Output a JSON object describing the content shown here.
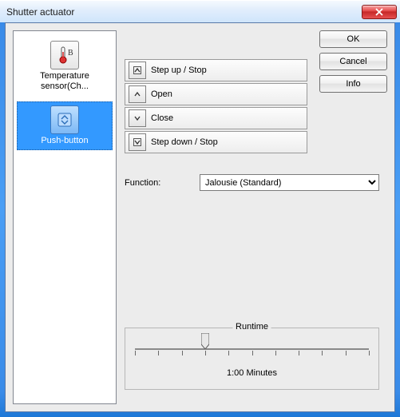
{
  "window": {
    "title": "Shutter actuator"
  },
  "buttons": {
    "ok": "OK",
    "cancel": "Cancel",
    "info": "Info"
  },
  "sidebar": {
    "items": [
      {
        "id": "temperature-sensor",
        "label": "Temperature sensor(Ch...",
        "selected": false
      },
      {
        "id": "push-button",
        "label": "Push-button",
        "selected": true
      }
    ]
  },
  "actions": [
    {
      "icon": "chevron-up-boxed-icon",
      "label": "Step up / Stop"
    },
    {
      "icon": "chevron-up-icon",
      "label": "Open"
    },
    {
      "icon": "chevron-down-icon",
      "label": "Close"
    },
    {
      "icon": "chevron-down-boxed-icon",
      "label": "Step down / Stop"
    }
  ],
  "function": {
    "label": "Function:",
    "selected": "Jalousie (Standard)",
    "options": [
      "Jalousie (Standard)"
    ]
  },
  "runtime": {
    "legend": "Runtime",
    "value_display": "1:00 Minutes",
    "value_seconds": 60,
    "min_seconds": 0,
    "max_seconds": 200,
    "position_pct": 30
  },
  "colors": {
    "selection": "#3399ff",
    "frame_blue": "#3a8be8",
    "close_red": "#c62828"
  }
}
